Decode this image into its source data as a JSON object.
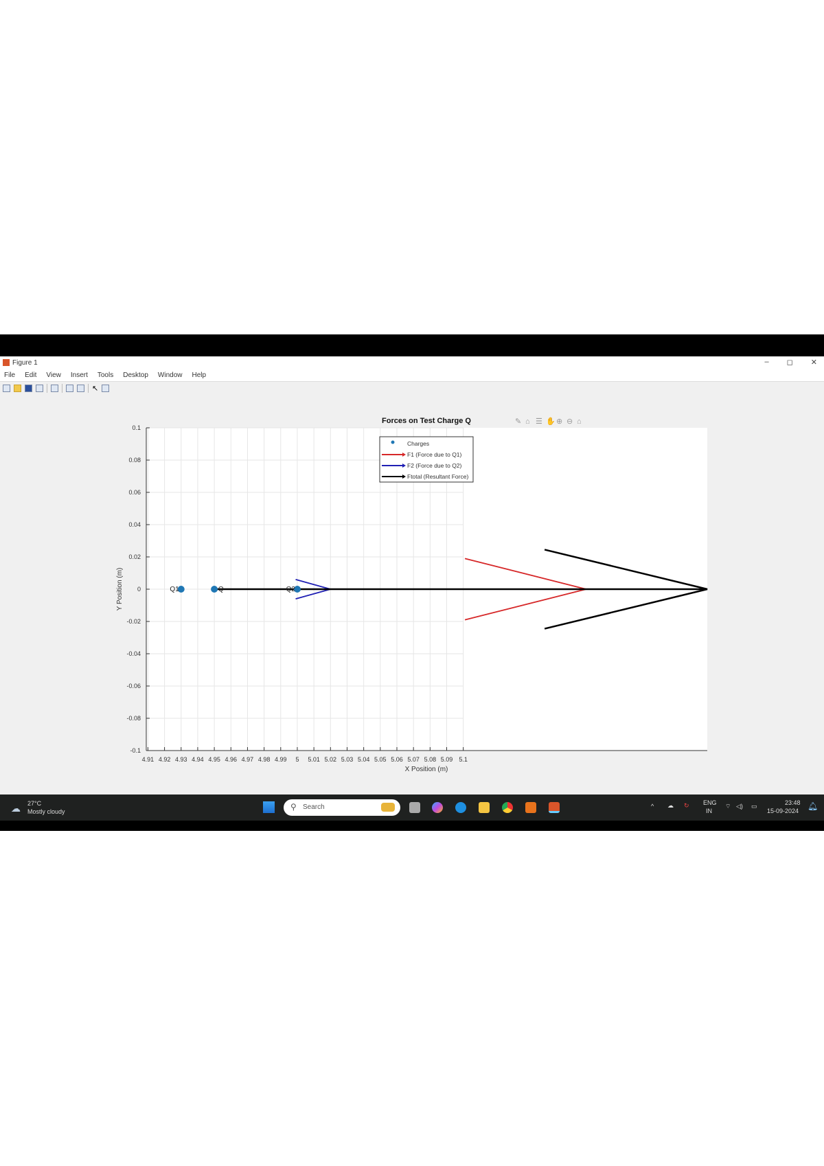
{
  "window": {
    "title": "Figure 1",
    "minimize": "–",
    "restore": "◻",
    "close": "✕"
  },
  "menu": [
    "File",
    "Edit",
    "View",
    "Insert",
    "Tools",
    "Desktop",
    "Window",
    "Help"
  ],
  "toolbar_icons": [
    "new-file-icon",
    "open-folder-icon",
    "save-icon",
    "print-icon",
    "print-preview-icon",
    "link-plot-icon",
    "insert-colorbar-icon",
    "pointer-icon",
    "property-editor-icon"
  ],
  "axes_toolbar": [
    "data-tip-icon",
    "brush-icon",
    "legend-icon",
    "pan-icon",
    "zoom-in-icon",
    "zoom-out-icon",
    "home-icon"
  ],
  "chart_data": {
    "type": "scatter",
    "title": "Forces on Test Charge Q",
    "xlabel": "X Position (m)",
    "ylabel": "Y Position (m)",
    "xlim": [
      4.909,
      5.247
    ],
    "ylim": [
      -0.1,
      0.1
    ],
    "xticks": [
      4.91,
      4.92,
      4.93,
      4.94,
      4.95,
      4.96,
      4.97,
      4.98,
      4.99,
      5,
      5.01,
      5.02,
      5.03,
      5.04,
      5.05,
      5.06,
      5.07,
      5.08,
      5.09,
      5.1
    ],
    "xtick_labels": [
      "4.91",
      "4.92",
      "4.93",
      "4.94",
      "4.95",
      "4.96",
      "4.97",
      "4.98",
      "4.99",
      "5",
      "5.01",
      "5.02",
      "5.03",
      "5.04",
      "5.05",
      "5.06",
      "5.07",
      "5.08",
      "5.09",
      "5.1"
    ],
    "yticks": [
      0.1,
      0.08,
      0.06,
      0.04,
      0.02,
      0,
      -0.02,
      -0.04,
      -0.06,
      -0.08,
      -0.1
    ],
    "ytick_labels": [
      "0.1",
      "0.08",
      "0.06",
      "0.04",
      "0.02",
      "0",
      "-0.02",
      "-0.04",
      "-0.06",
      "-0.08",
      "-0.1"
    ],
    "grid": true,
    "charges": [
      {
        "x": 4.93,
        "y": 0,
        "label": "Q1",
        "lx": 4.926
      },
      {
        "x": 4.95,
        "y": 0,
        "label": "Q",
        "lx": 4.954
      },
      {
        "x": 5.0,
        "y": 0,
        "label": "Q2",
        "lx": 4.996
      }
    ],
    "arrows": [
      {
        "name": "F1",
        "color": "#d62728",
        "x0": 4.95,
        "x1": 5.174,
        "head_back": 5.101,
        "head_half": 0.019
      },
      {
        "name": "F2",
        "color": "#1f1fb4",
        "x0": 4.95,
        "x1": 5.02,
        "head_back": 4.999,
        "head_half": 0.006
      },
      {
        "name": "Ftotal",
        "color": "#000000",
        "x0": 4.95,
        "x1": 5.247,
        "head_back": 5.149,
        "head_half": 0.0245
      }
    ],
    "legend": {
      "placement": "top-center",
      "entries": [
        {
          "label": "Charges",
          "color": "#1f77b4",
          "kind": "dot"
        },
        {
          "label": "F1 (Force due to Q1)",
          "color": "#d62728",
          "kind": "arrow"
        },
        {
          "label": "F2 (Force due to Q2)",
          "color": "#1f1fb4",
          "kind": "arrow"
        },
        {
          "label": "Ftotal (Resultant Force)",
          "color": "#000000",
          "kind": "arrow"
        }
      ]
    },
    "charge_color": "#1f77b4"
  },
  "taskbar": {
    "weather_temp": "27°C",
    "weather_desc": "Mostly cloudy",
    "search_placeholder": "Search",
    "lang": "ENG",
    "region": "IN",
    "time": "23:48",
    "date": "15-09-2024"
  }
}
